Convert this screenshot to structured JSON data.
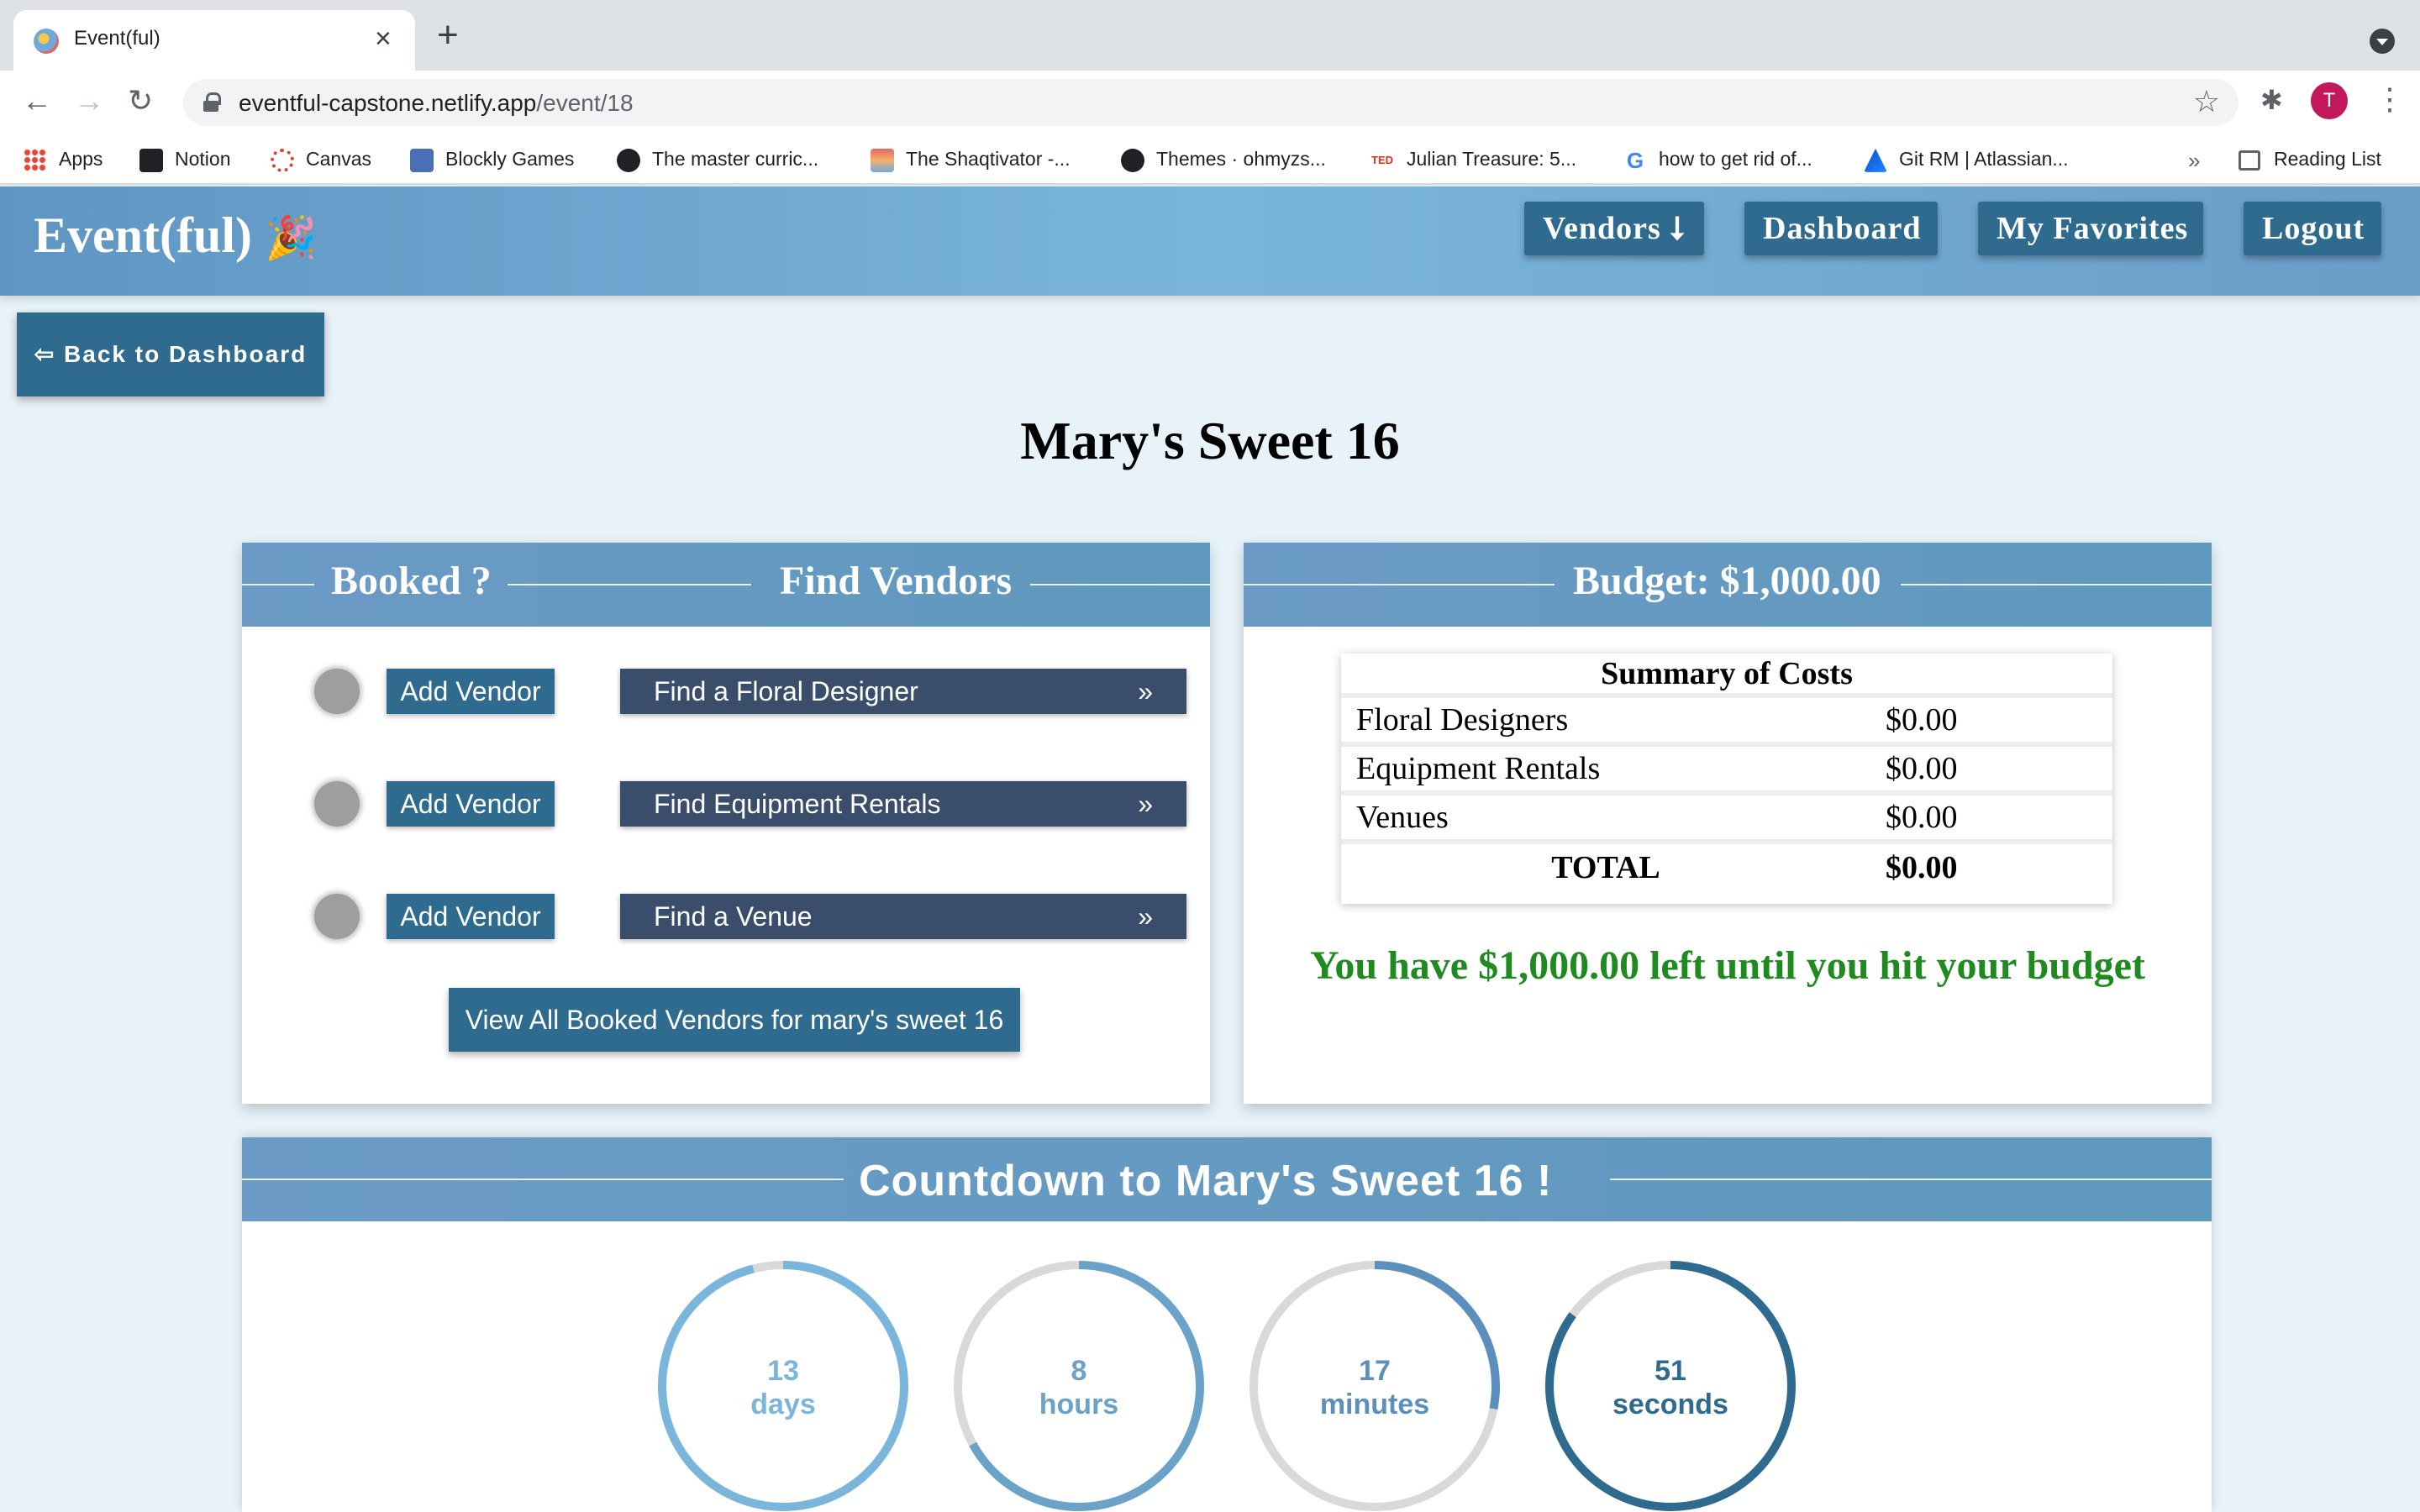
{
  "browser": {
    "tab_title": "Event(ful)",
    "url_host": "eventful-capstone.netlify.app",
    "url_path": "/event/18",
    "profile_initial": "T",
    "bookmarks": [
      "Apps",
      "Notion",
      "Canvas",
      "Blockly Games",
      "The master curric...",
      "The Shaqtivator -...",
      "Themes · ohmyzs...",
      "Julian Treasure: 5...",
      "how to get rid of...",
      "Git RM | Atlassian..."
    ],
    "reading_list": "Reading List"
  },
  "nav": {
    "brand": "Event(ful)",
    "brand_icon": "🎉",
    "vendors": "Vendors ⭣",
    "dashboard": "Dashboard",
    "favorites": "My Favorites",
    "logout": "Logout"
  },
  "page": {
    "back": "⇦ Back to Dashboard",
    "title": "Mary's Sweet 16"
  },
  "vendors_card": {
    "booked_header": "Booked ?",
    "find_header": "Find Vendors",
    "add_label": "Add Vendor",
    "arrow": "»",
    "rows": [
      {
        "find": "Find a Floral Designer"
      },
      {
        "find": "Find Equipment Rentals"
      },
      {
        "find": "Find a Venue"
      }
    ],
    "view_all": "View All Booked Vendors for mary's sweet 16"
  },
  "budget_card": {
    "header": "Budget: $1,000.00",
    "summary_title": "Summary of Costs",
    "items": [
      {
        "name": "Floral Designers",
        "cost": "$0.00"
      },
      {
        "name": "Equipment Rentals",
        "cost": "$0.00"
      },
      {
        "name": "Venues",
        "cost": "$0.00"
      }
    ],
    "total_label": "TOTAL",
    "total_value": "$0.00",
    "remaining": "You have $1,000.00 left until you hit your budget",
    "remaining_color": "#1f8a1f"
  },
  "countdown": {
    "header": "Countdown to Mary's Sweet 16 !",
    "units": [
      {
        "value": "13",
        "label": "days",
        "fraction": 0.96,
        "color": "#7ab6dc"
      },
      {
        "value": "8",
        "label": "hours",
        "fraction": 0.67,
        "color": "#6aa2c8"
      },
      {
        "value": "17",
        "label": "minutes",
        "fraction": 0.28,
        "color": "#5b8fbd"
      },
      {
        "value": "51",
        "label": "seconds",
        "fraction": 0.85,
        "color": "#2f6b8e"
      }
    ]
  }
}
